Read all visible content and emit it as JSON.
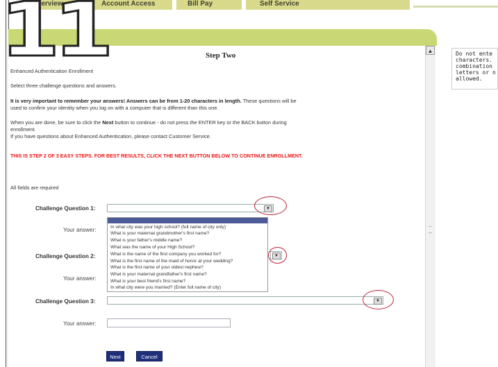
{
  "tabs": [
    "Overview",
    "Account Access",
    "Bill Pay",
    "Self Service"
  ],
  "step_number": "11",
  "page": {
    "step_title": "Step Two",
    "section_title": "Enhanced Authentication Enrollment",
    "intro": "Select three challenge questions and answers.",
    "important_bold": "It is very important to remember your answers! Answers can be from 1-20 characters in length.",
    "important_rest": " These questions will be",
    "important_line2": "used to confirm your identity when you log on with a computer that is different than this one.",
    "done_pre": "When you are done, be sure to click the ",
    "done_bold": "Next",
    "done_post": " button to continue - do not press the ENTER key or the BACK button during",
    "done_line2": "enrollment.",
    "questions_line": "If you have questions about Enhanced Authentication, please contact Customer Service.",
    "step_banner": "THIS IS STEP 2 OF 3 EASY STEPS. FOR BEST RESULTS, CLICK THE NEXT BUTTON BELOW TO CONTINUE ENROLLMENT.",
    "required_note": "All fields are required"
  },
  "form": {
    "q1_label": "Challenge Question 1:",
    "q2_label": "Challenge Question 2:",
    "q3_label": "Challenge Question 3:",
    "answer_label": "Your answer:",
    "q1_selected": "",
    "q3_selected": "",
    "answer1": "",
    "answer3": ""
  },
  "dropdown_options": [
    "In what city was your high school? (full name of city only)",
    "What is your maternal grandmother's first name?",
    "What is your father's middle name?",
    "What was the name of your High School?",
    "What is the name of the first company you worked for?",
    "What is the first name of the maid of honor at your wedding?",
    "What is the first name of your oldest nephew?",
    "What is your maternal grandfather's first name?",
    "What is your best friend's first name?",
    "In what city were you married? (Enter full name of city)"
  ],
  "buttons": {
    "next": "Next",
    "cancel": "Cancel"
  },
  "side_note": [
    "Do not ente",
    "characters.",
    "combination",
    "letters or n",
    "allowed."
  ],
  "colors": {
    "accent_green": "#c9d775",
    "tab_bg": "#d8d98a",
    "button_navy": "#1f2f7a",
    "banner_red": "#e11111",
    "highlight_circle": "#c0203a"
  }
}
